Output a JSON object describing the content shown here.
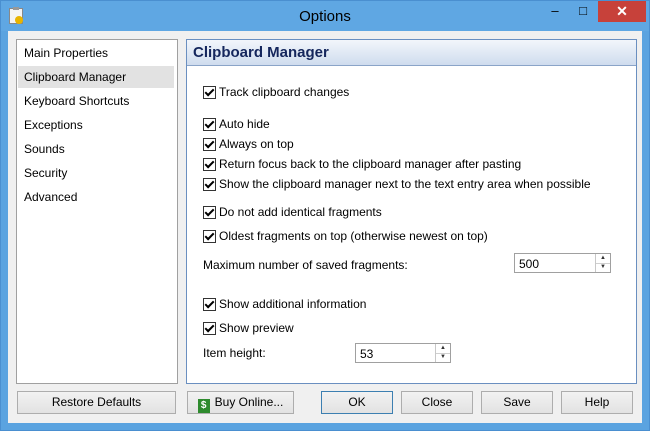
{
  "window": {
    "title": "Options"
  },
  "titlebar": {
    "minimize": "–",
    "maximize": "□",
    "close": "✕"
  },
  "sidebar": {
    "items": [
      {
        "label": "Main Properties",
        "active": false
      },
      {
        "label": "Clipboard Manager",
        "active": true
      },
      {
        "label": "Keyboard Shortcuts",
        "active": false
      },
      {
        "label": "Exceptions",
        "active": false
      },
      {
        "label": "Sounds",
        "active": false
      },
      {
        "label": "Security",
        "active": false
      },
      {
        "label": "Advanced",
        "active": false
      }
    ]
  },
  "panel": {
    "title": "Clipboard Manager",
    "options": {
      "track_changes": {
        "label": "Track clipboard changes",
        "checked": true
      },
      "auto_hide": {
        "label": "Auto hide",
        "checked": true
      },
      "always_on_top": {
        "label": "Always on top",
        "checked": true
      },
      "return_focus": {
        "label": "Return focus back to the clipboard manager after pasting",
        "checked": true
      },
      "show_next_to_text": {
        "label": "Show the clipboard manager next to the text entry area when possible",
        "checked": true
      },
      "no_identical": {
        "label": "Do not add identical fragments",
        "checked": true
      },
      "oldest_on_top": {
        "label": "Oldest fragments on top (otherwise newest on top)",
        "checked": true
      },
      "show_additional": {
        "label": "Show additional information",
        "checked": true
      },
      "show_preview": {
        "label": "Show preview",
        "checked": true
      }
    },
    "max_fragments": {
      "label": "Maximum number of saved fragments:",
      "value": "500"
    },
    "item_height": {
      "label": "Item height:",
      "value": "53"
    }
  },
  "buttons": {
    "restore_defaults": "Restore Defaults",
    "buy_online": "Buy Online...",
    "ok": "OK",
    "close": "Close",
    "save": "Save",
    "help": "Help"
  },
  "icons": {
    "buy_online": "$"
  }
}
